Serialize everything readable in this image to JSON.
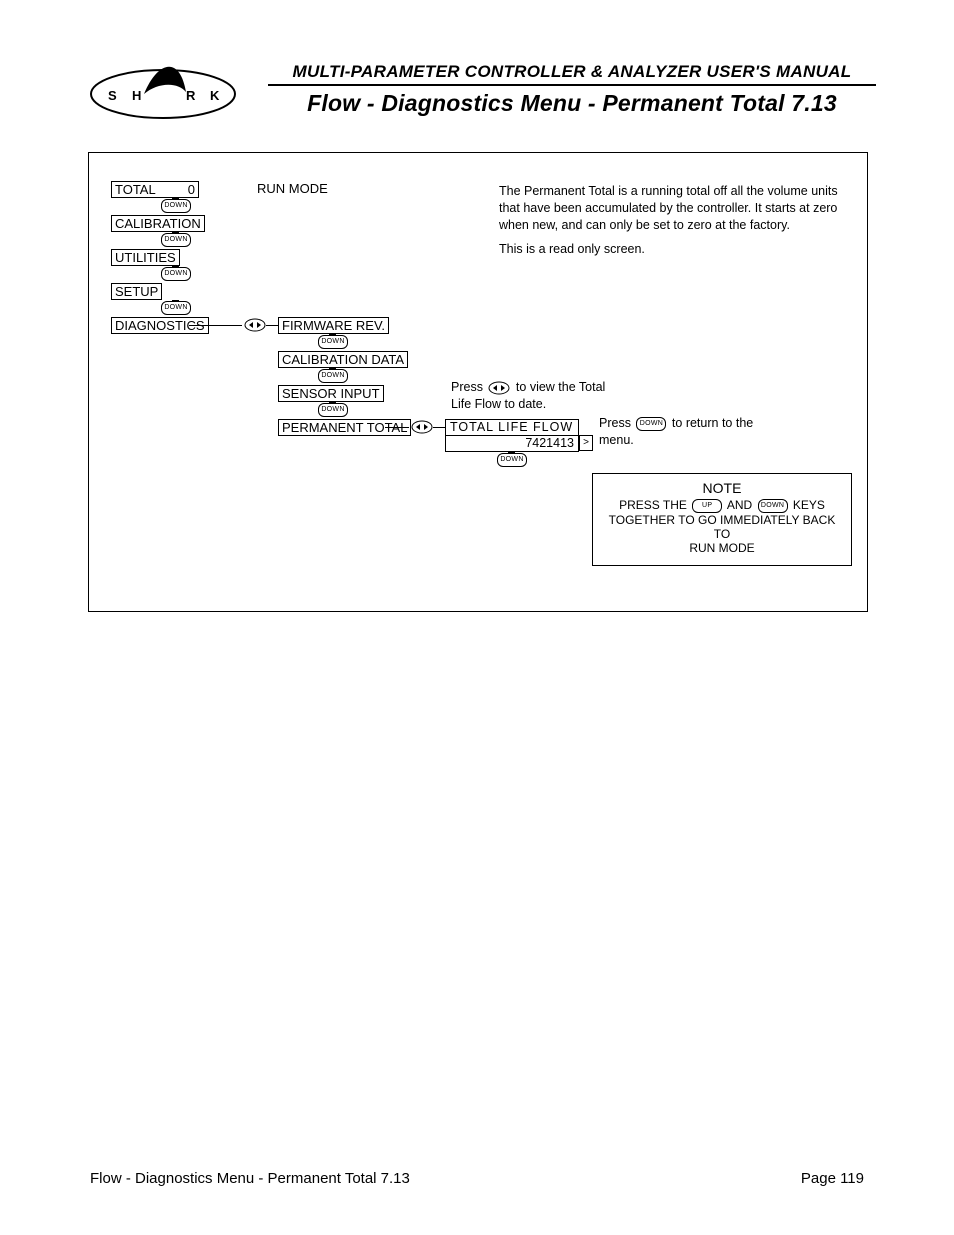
{
  "header": {
    "logo_letters": [
      "S",
      "H",
      "A",
      "R",
      "K"
    ],
    "manual_title": "MULTI-PARAMETER CONTROLLER & ANALYZER USER'S MANUAL",
    "page_title": "Flow - Diagnostics Menu - Permanent Total 7.13"
  },
  "menu": {
    "run_mode": "RUN MODE",
    "items": [
      {
        "label": "TOTAL",
        "value": "0"
      },
      {
        "label": "CALIBRATION"
      },
      {
        "label": "UTILITIES"
      },
      {
        "label": "SETUP"
      },
      {
        "label": "DIAGNOSTICS"
      }
    ],
    "diag_children": [
      "FIRMWARE REV.",
      "CALIBRATION DATA",
      "SENSOR INPUT",
      "PERMANENT TOTAL"
    ],
    "leaf": {
      "label": "TOTAL  LIFE  FLOW",
      "value": "7421413",
      "gt": ">"
    }
  },
  "buttons": {
    "down": "DOWN",
    "up": "UP"
  },
  "text": {
    "desc1": "The Permanent Total is a running total off all the volume units that have been accumulated by the controller. It starts at zero when new, and can only be set to zero at the factory.",
    "desc2": "This is a read only screen.",
    "view_total_pre": "Press",
    "view_total_post": "to view the Total Life Flow to date.",
    "return_pre": "Press",
    "return_post": "to return to the menu."
  },
  "note": {
    "title": "NOTE",
    "line1_a": "PRESS THE",
    "line1_b": "AND",
    "line1_c": "KEYS",
    "line2": "TOGETHER TO GO IMMEDIATELY BACK TO",
    "line3": "RUN MODE"
  },
  "footer": {
    "left": "Flow - Diagnostics Menu - Permanent Total 7.13",
    "right": "Page 119"
  }
}
